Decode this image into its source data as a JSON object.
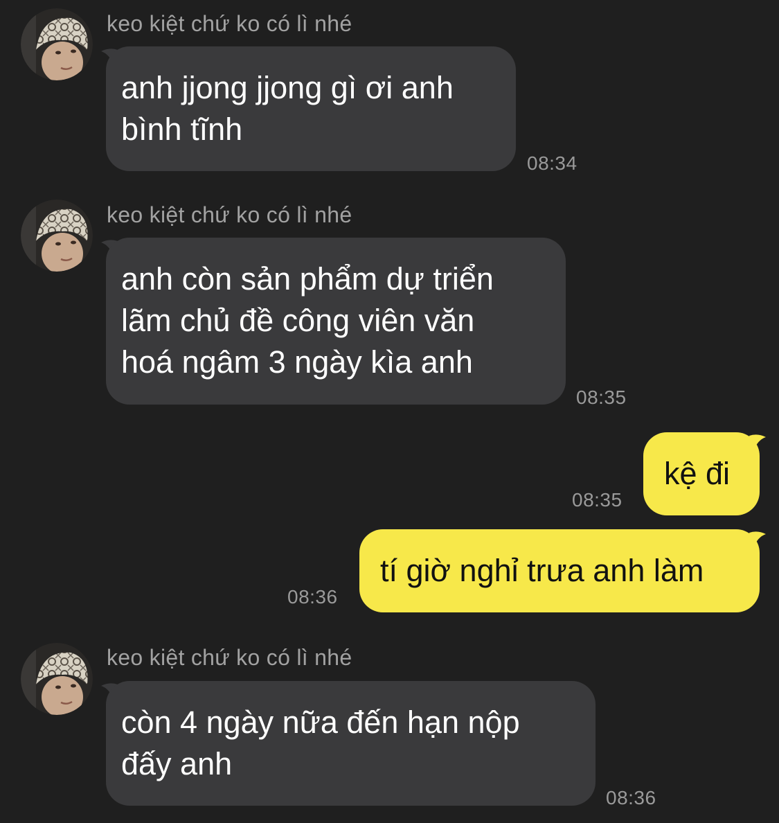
{
  "chat": {
    "messages": [
      {
        "direction": "incoming",
        "sender": "keo kiệt chứ ko có lì nhé",
        "lines": [
          "anh jjong jjong gì ơi anh",
          "bình tĩnh"
        ],
        "time": "08:34"
      },
      {
        "direction": "incoming",
        "sender": "keo kiệt chứ ko có lì nhé",
        "lines": [
          "anh còn sản phẩm dự triển",
          "lãm chủ đề công viên văn",
          "hoá ngâm 3 ngày kìa anh"
        ],
        "time": "08:35"
      },
      {
        "direction": "outgoing",
        "lines": [
          "kệ đi"
        ],
        "time": "08:35"
      },
      {
        "direction": "outgoing",
        "lines": [
          "tí giờ nghỉ trưa anh làm"
        ],
        "time": "08:36"
      },
      {
        "direction": "incoming",
        "sender": "keo kiệt chứ ko có lì nhé",
        "lines": [
          "còn 4 ngày nữa đến hạn nộp",
          "đấy anh"
        ],
        "time": "08:36"
      }
    ]
  },
  "colors": {
    "background": "#1f1f1f",
    "incoming_bubble": "#3a3a3c",
    "outgoing_bubble": "#f7e84a",
    "sender_text": "#a2a2a2",
    "timestamp_text": "#9a9a9a"
  },
  "icons": {
    "avatar": "profile-photo-avatar"
  }
}
